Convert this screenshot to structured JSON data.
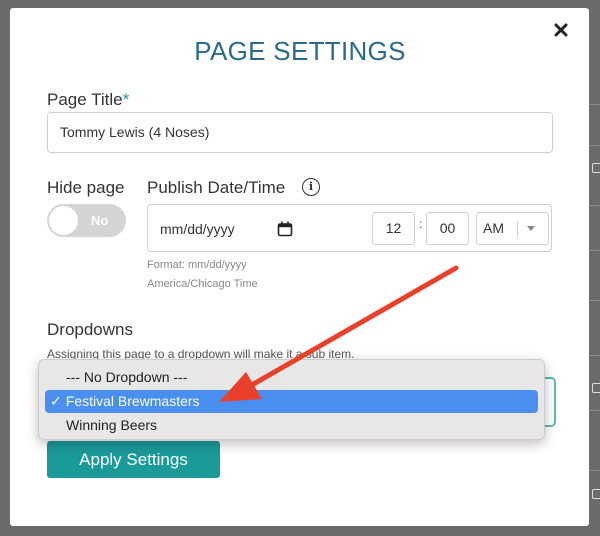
{
  "modal": {
    "title": "PAGE SETTINGS",
    "close_symbol": "✕"
  },
  "page_title": {
    "label": "Page Title",
    "required_mark": "*",
    "value": "Tommy Lewis (4 Noses)"
  },
  "hide_page": {
    "label": "Hide page",
    "toggle_text": "No",
    "value": false
  },
  "publish": {
    "label": "Publish Date/Time",
    "info_symbol": "i",
    "date_placeholder": "mm/dd/yyyy",
    "hour": "12",
    "separator": ":",
    "minute": "00",
    "ampm": "AM",
    "format_hint": "Format: mm/dd/yyyy",
    "timezone_hint": "America/Chicago Time"
  },
  "dropdowns": {
    "label": "Dropdowns",
    "description": "Assigning this page to a dropdown will make it a sub item.",
    "options": [
      {
        "label": "--- No Dropdown ---",
        "selected": false
      },
      {
        "label": "Festival Brewmasters",
        "selected": true
      },
      {
        "label": "Winning Beers",
        "selected": false
      }
    ],
    "check_symbol": "✓"
  },
  "apply_button": {
    "label": "Apply Settings"
  },
  "colors": {
    "accent": "#1a9a99",
    "title": "#2b6a8d",
    "selection": "#4a8ff0",
    "annotation_arrow": "#e8402a"
  }
}
